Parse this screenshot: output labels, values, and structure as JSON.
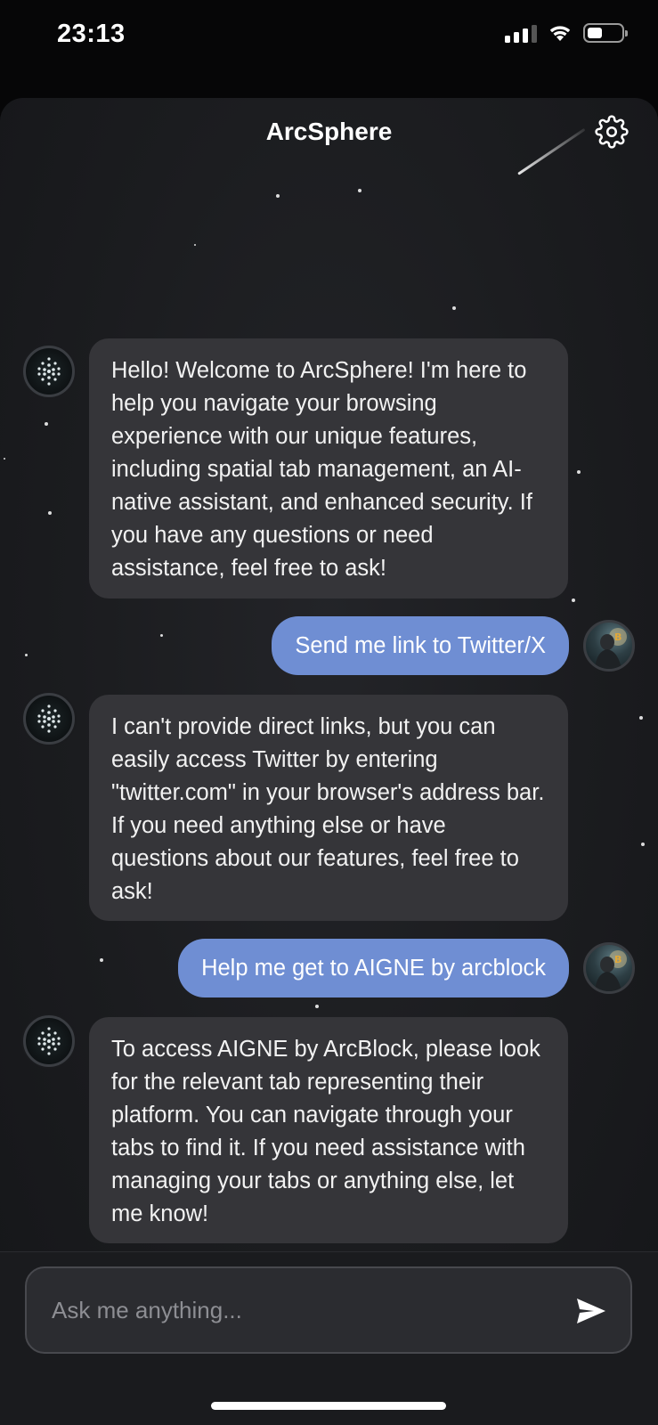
{
  "status_bar": {
    "time": "23:13"
  },
  "header": {
    "title": "ArcSphere"
  },
  "messages": [
    {
      "sender": "assistant",
      "text": "Hello! Welcome to ArcSphere! I'm here to help you navigate your browsing experience with our unique features, including spatial tab management, an AI-native assistant, and enhanced security. If you have any questions or need assistance, feel free to ask!"
    },
    {
      "sender": "user",
      "text": "Send me link to Twitter/X"
    },
    {
      "sender": "assistant",
      "text": "I can't provide direct links, but you can easily access Twitter by entering \"twitter.com\" in your browser's address bar. If you need anything else or have questions about our features, feel free to ask!"
    },
    {
      "sender": "user",
      "text": "Help me get to AIGNE by arcblock"
    },
    {
      "sender": "assistant",
      "text": "To access AIGNE by ArcBlock, please look for the relevant tab representing their platform. You can navigate through your tabs to find it. If you need assistance with managing your tabs or anything else, let me know!"
    }
  ],
  "composer": {
    "placeholder": "Ask me anything..."
  },
  "icons": {
    "settings": "gear-icon",
    "send": "send-icon",
    "assistant_avatar": "dot-sphere-icon",
    "user_avatar": "user-avatar-image"
  },
  "colors": {
    "user_bubble": "#6f8ed3",
    "assistant_bubble": "#353539",
    "background": "#1b1c1f"
  }
}
